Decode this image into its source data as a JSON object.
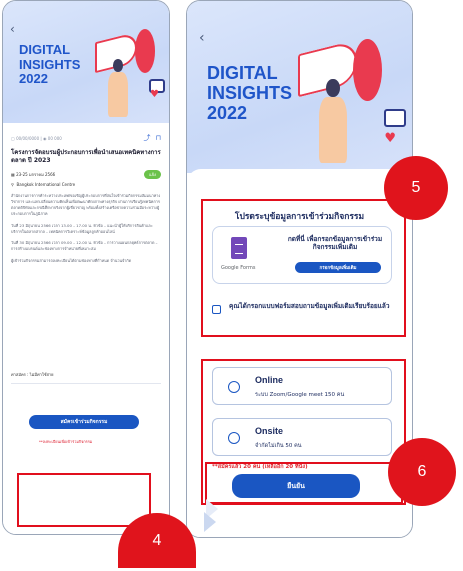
{
  "left_screen": {
    "hero": {
      "lines": [
        "DIGITAL",
        "INSIGHTS",
        "2022"
      ]
    },
    "meta": {
      "date": "00/00/0000",
      "views": "00 000"
    },
    "title": "โครงการจัดอบรมผู้ประกอบการเพื่อนำเสนอเทคนิคทางการตลาด ปี 2023",
    "event_date": "23-25 มกราคม 2566",
    "badge": "แจ้ง",
    "location": "Bangkok International Centre",
    "paragraphs": [
      "สำนักงานการการค้าระหว่างประเทศขอเชิญผู้ประกอบการที่สนใจเข้าร่วมกิจกรรมสัมมนาทางวิชาการ และแลกเปลี่ยนความคิดเห็นเพื่อพัฒนาศักยภาพทางธุรกิจ ผ่านการเรียนรู้เทคนิคการตลาดดิจิทัลและกรณีศึกษาจริงจากผู้เชี่ยวชาญ พร้อมทั้งสร้างเครือข่ายความร่วมมือระหว่างผู้ประกอบการในภูมิภาค",
      "วันที่ 23 มิถุนายน 2566 เวลา 13.00 – 17.00 น. หัวข้อ – แนะนำผู้ให้บริการสินค้าและบริการในตลาดสากล – เทคนิคการวิเคราะห์ข้อมูลลูกค้าออนไลน์",
      "วันที่ 30 มิถุนายน 2566 เวลา 09.00 – 12.00 น. หัวข้อ – การวางแผนกลยุทธ์การตลาด – การสร้างแบรนด์และช่องทางการจำหน่ายที่เหมาะสม",
      "ผู้เข้าร่วมกิจกรรมสามารถลงทะเบียนได้ตามช่องทางที่กำหนด จำนวนจำกัด"
    ],
    "fee": "ค่าสมัคร : ไม่มีค่าใช้จ่าย",
    "register_button": "สมัครเข้าร่วมกิจกรรม",
    "note": "**ลงทะเบียนเพื่อเข้าร่วมกิจกรรม"
  },
  "right_screen": {
    "hero": {
      "lines": [
        "DIGITAL",
        "INSIGHTS",
        "2022"
      ]
    },
    "form_title": "โปรดระบุข้อมูลการเข้าร่วมกิจกรรม",
    "gform_text": "กดที่นี่ เพื่อกรอกข้อมูลการเข้าร่วมกิจกรรมเพิ่มเติม",
    "gform_brand": "Google Forms",
    "gform_button": "กรอกข้อมูลเพิ่มเติม",
    "consent": "คุณได้กรอกแบบฟอร์มสอบถามข้อมูลเพิ่มเติมเรียบร้อยแล้ว",
    "options": [
      {
        "name": "Online",
        "desc": "ระบบ Zoom/Google meet 150 คน"
      },
      {
        "name": "Onsite",
        "desc": "จำกัดไม่เกิน 50 คน"
      }
    ],
    "quota": "**สมัครแล้ว 20 คน (เหลืออีก 20 ที่นั่ง)",
    "confirm_button": "ยืนยัน"
  },
  "annotations": {
    "four": "4",
    "five": "5",
    "six": "6"
  },
  "colors": {
    "primary": "#1a56c2",
    "annotation_red": "#e0141c",
    "hero_title": "#1f55c9"
  }
}
